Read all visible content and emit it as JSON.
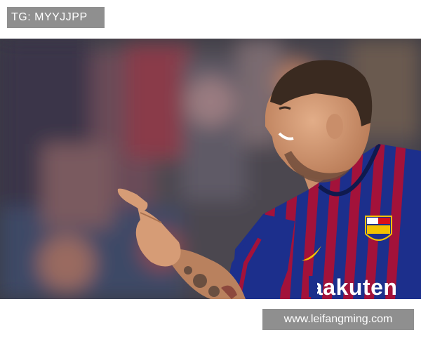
{
  "watermark_top": {
    "text": "TG: MYYJJPP"
  },
  "watermark_bottom": {
    "text": "www.leifangming.com"
  },
  "photo": {
    "subject": "footballer smiling and pointing",
    "jersey_sponsor": "Rakuten",
    "colors": {
      "blue": "#1c2f8c",
      "garnet": "#a3123a",
      "skin": "#d9a07a",
      "hair": "#3a2a20",
      "crowd": "#4a4650",
      "gold": "#f2c200"
    }
  }
}
